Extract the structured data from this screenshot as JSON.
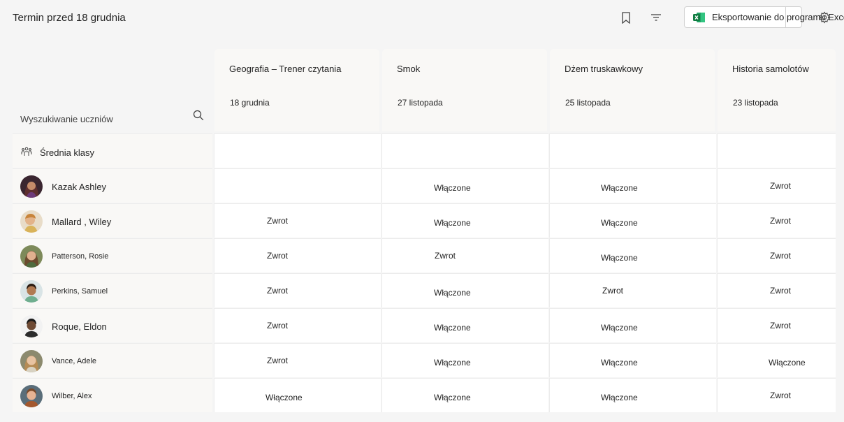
{
  "header": {
    "title": "Termin przed 18 grudnia",
    "export_label": "Eksportowanie do programu Excel",
    "icons": [
      "bookmark-icon",
      "filter-icon",
      "excel-icon",
      "gear-icon"
    ]
  },
  "search": {
    "label": "Wyszukiwanie uczniów"
  },
  "assignments": [
    {
      "title": "Geografia – Trener czytania",
      "date": "18 grudnia"
    },
    {
      "title": "Smok",
      "date": "27 listopada"
    },
    {
      "title": "Dżem truskawkowy",
      "date": "25 listopada"
    },
    {
      "title": "Historia samolotów",
      "date": "23 listopada"
    }
  ],
  "class_average": {
    "label": "Średnia klasy"
  },
  "students": [
    {
      "name": "Kazak Ashley",
      "statuses": [
        "",
        "Włączone",
        "Włączone",
        "Zwrot"
      ]
    },
    {
      "name": "Mallard , Wiley",
      "statuses": [
        "Zwrot",
        "Włączone",
        "Włączone",
        "Zwrot"
      ]
    },
    {
      "name": "Patterson, Rosie",
      "statuses": [
        "Zwrot",
        "Zwrot",
        "Włączone",
        "Zwrot"
      ]
    },
    {
      "name": "Perkins, Samuel",
      "statuses": [
        "Zwrot",
        "Włączone",
        "Zwrot",
        "Zwrot"
      ]
    },
    {
      "name": "Roque, Eldon",
      "statuses": [
        "Zwrot",
        "Włączone",
        "Włączone",
        "Zwrot"
      ]
    },
    {
      "name": "Vance, Adele",
      "statuses": [
        "Zwrot",
        "Włączone",
        "Włączone",
        "Włączone"
      ]
    },
    {
      "name": "Wilber, Alex",
      "statuses": [
        "Włączone",
        "Włączone",
        "Włączone",
        "Zwrot"
      ]
    }
  ],
  "colors": {
    "background": "#f5f5f5",
    "header_cell": "#f9f8f6",
    "excel_green": "#107c41"
  }
}
